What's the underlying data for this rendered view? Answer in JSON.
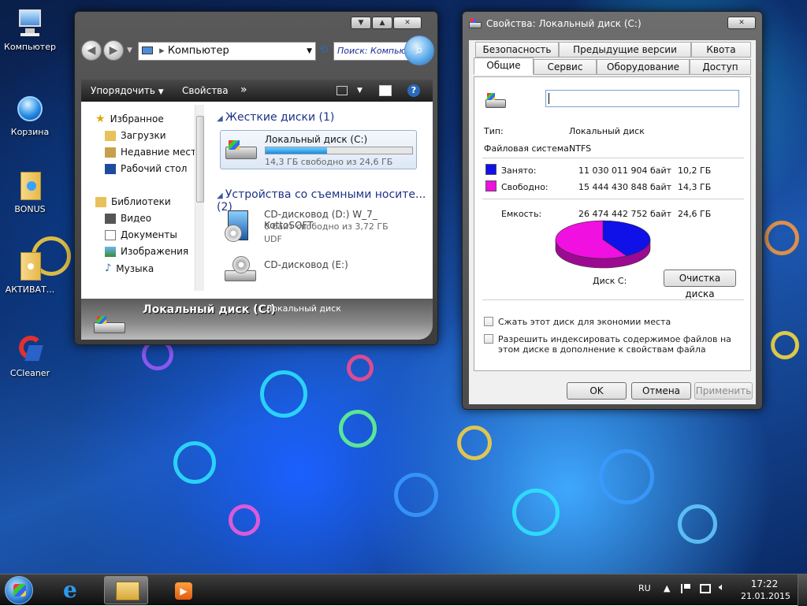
{
  "desktop": {
    "icons": [
      {
        "label": "Компьютер",
        "icon": "computer-icon"
      },
      {
        "label": "Корзина",
        "icon": "recycle-bin-icon"
      },
      {
        "label": "BONUS",
        "icon": "folder-icon"
      },
      {
        "label": "АКТИВАТ...",
        "icon": "folder-icon"
      },
      {
        "label": "CCleaner",
        "icon": "ccleaner-icon"
      }
    ]
  },
  "explorer": {
    "address": "Компьютер",
    "search_placeholder": "Поиск: Компьют...",
    "toolbar": {
      "organize": "Упорядочить",
      "properties": "Свойства",
      "more": "»"
    },
    "nav": {
      "favorites": "Избранное",
      "downloads": "Загрузки",
      "recent": "Недавние места",
      "desktop": "Рабочий стол",
      "libraries": "Библиотеки",
      "video": "Видео",
      "documents": "Документы",
      "images": "Изображения",
      "music": "Музыка"
    },
    "groups": {
      "hard_drives": "Жесткие диски (1)",
      "removable": "Устройства со съемными носите... (2)"
    },
    "drives": {
      "c_name": "Локальный диск (C:)",
      "c_free": "14,3 ГБ свободно из 24,6 ГБ",
      "c_used_fraction": 0.42,
      "d_name": "CD-дисковод (D:) W_7_ KottoSOFT",
      "d_free": "0 байт свободно из 3,72 ГБ",
      "d_fs": "UDF",
      "e_name": "CD-дисковод (E:)"
    },
    "details": {
      "title": "Локальный диск (C:)",
      "subtitle": "Локальный диск"
    }
  },
  "properties": {
    "title": "Свойства: Локальный диск (C:)",
    "tabs_top": [
      "Безопасность",
      "Предыдущие версии",
      "Квота"
    ],
    "tabs_bottom": [
      "Общие",
      "Сервис",
      "Оборудование",
      "Доступ"
    ],
    "name_value": "",
    "type_label": "Тип:",
    "type_value": "Локальный диск",
    "fs_label": "Файловая система:",
    "fs_value": "NTFS",
    "used_label": "Занято:",
    "used_bytes": "11 030 011 904 байт",
    "used_gb": "10,2 ГБ",
    "free_label": "Свободно:",
    "free_bytes": "15 444 430 848 байт",
    "free_gb": "14,3 ГБ",
    "capacity_label": "Емкость:",
    "capacity_bytes": "26 474 442 752 байт",
    "capacity_gb": "24,6 ГБ",
    "disk_label": "Диск C:",
    "cleanup_button": "Очистка диска",
    "compress_label": "Сжать этот диск для экономии места",
    "index_label": "Разрешить индексировать содержимое файлов на этом диске в дополнение к свойствам файла",
    "ok": "OK",
    "cancel": "Отмена",
    "apply": "Применить",
    "used_fraction": 0.417,
    "used_color": "#1010e8",
    "free_color": "#f010e0"
  },
  "taskbar": {
    "lang": "RU",
    "time": "17:22",
    "date": "21.01.2015"
  }
}
